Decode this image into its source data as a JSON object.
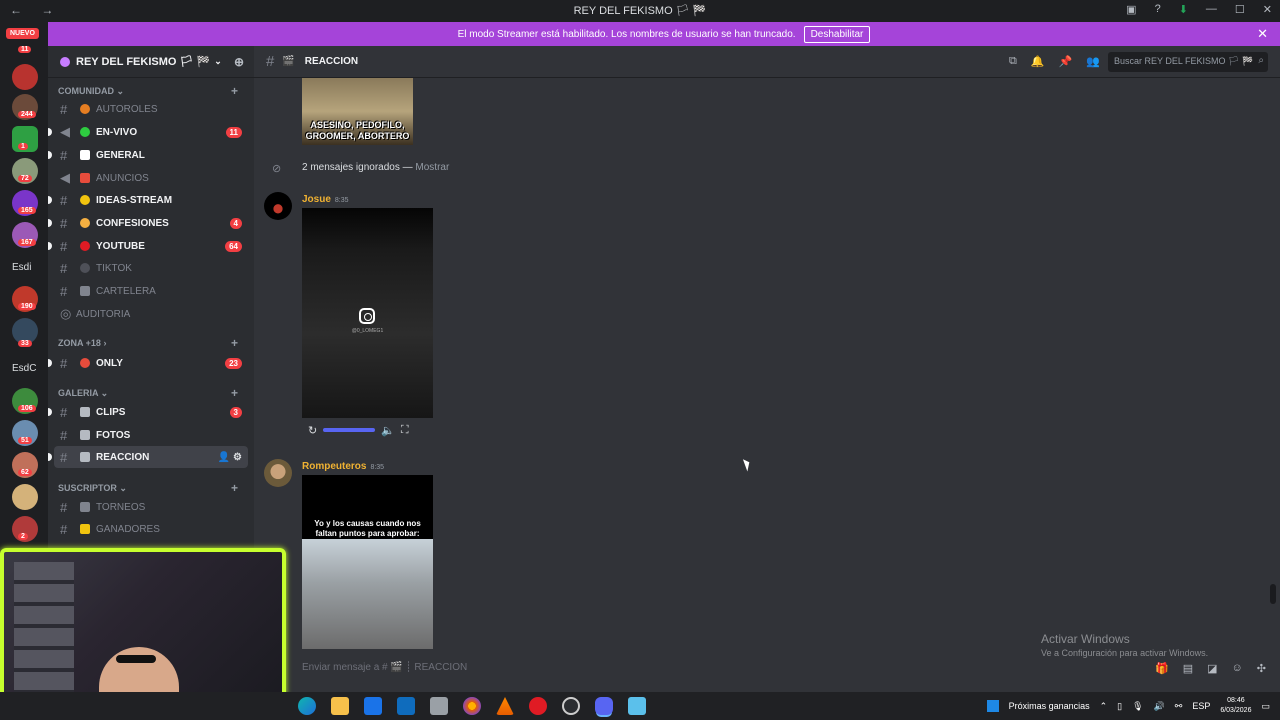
{
  "window": {
    "title": "REY DEL FEKISMO 🏳 🏁",
    "nav_arrows": "← →"
  },
  "streamer_bar": {
    "message": "El modo Streamer está habilitado. Los nombres de usuario se han truncado.",
    "button": "Deshabilitar",
    "close": "✕"
  },
  "rail": {
    "nuevo": "NUEVO",
    "badges": [
      "11",
      "244",
      "1",
      "72",
      "165",
      "167",
      "190",
      "33",
      "106",
      "51",
      "62",
      "2"
    ],
    "labels": [
      "Esdi",
      "EsdC"
    ]
  },
  "sidebar": {
    "guild_name": "REY DEL FEKISMO 🏳 🏁",
    "categories": [
      {
        "label": "COMUNIDAD"
      },
      {
        "label": "ZONA +18"
      },
      {
        "label": "GALERIA"
      },
      {
        "label": "SUSCRIPTOR"
      }
    ],
    "channels": [
      {
        "name": "AUTOROLES"
      },
      {
        "name": "EN-VIVO",
        "badge": "11"
      },
      {
        "name": "GENERAL"
      },
      {
        "name": "ANUNCIOS"
      },
      {
        "name": "IDEAS-STREAM"
      },
      {
        "name": "CONFESIONES",
        "badge": "4"
      },
      {
        "name": "YOUTUBE",
        "badge": "64"
      },
      {
        "name": "TIKTOK"
      },
      {
        "name": "CARTELERA"
      },
      {
        "name": "AUDITORIA"
      },
      {
        "name": "ONLY",
        "badge": "23"
      },
      {
        "name": "CLIPS",
        "badge": "3"
      },
      {
        "name": "FOTOS"
      },
      {
        "name": "REACCION"
      },
      {
        "name": "TORNEOS"
      },
      {
        "name": "GANADORES"
      }
    ]
  },
  "header": {
    "channel": "REACCION",
    "search_placeholder": "Buscar REY DEL FEKISMO 🏳 🏁"
  },
  "messages": {
    "meme_caption_1": "ASESINO, PEDOFILO,",
    "meme_caption_2": "GROOMER, ABORTERO",
    "ignored": "2 mensajes ignorados —",
    "ignored_show": "Mostrar",
    "msg1": {
      "author": "Josue",
      "time": "8:35",
      "video_handle": "@0_LOMEG1"
    },
    "msg2": {
      "author": "Rompeuteros",
      "time": "8:35",
      "meme_text": "Yo y los causas cuando nos faltan puntos para aprobar:"
    }
  },
  "composer": {
    "placeholder": "Enviar mensaje a # 🎬 ┊ REACCION"
  },
  "watermark": {
    "line1": "Activar Windows",
    "line2": "Ve a Configuración para activar Windows."
  },
  "taskbar": {
    "widget": "Próximas ganancias",
    "lang": "ESP",
    "time": "08:46",
    "date": "6/03/2026"
  },
  "colors": {
    "streamer_bar": "#a544d9",
    "webcam_border": "#c6ff2e",
    "author": "#f0b232",
    "badge": "#f23f43"
  }
}
